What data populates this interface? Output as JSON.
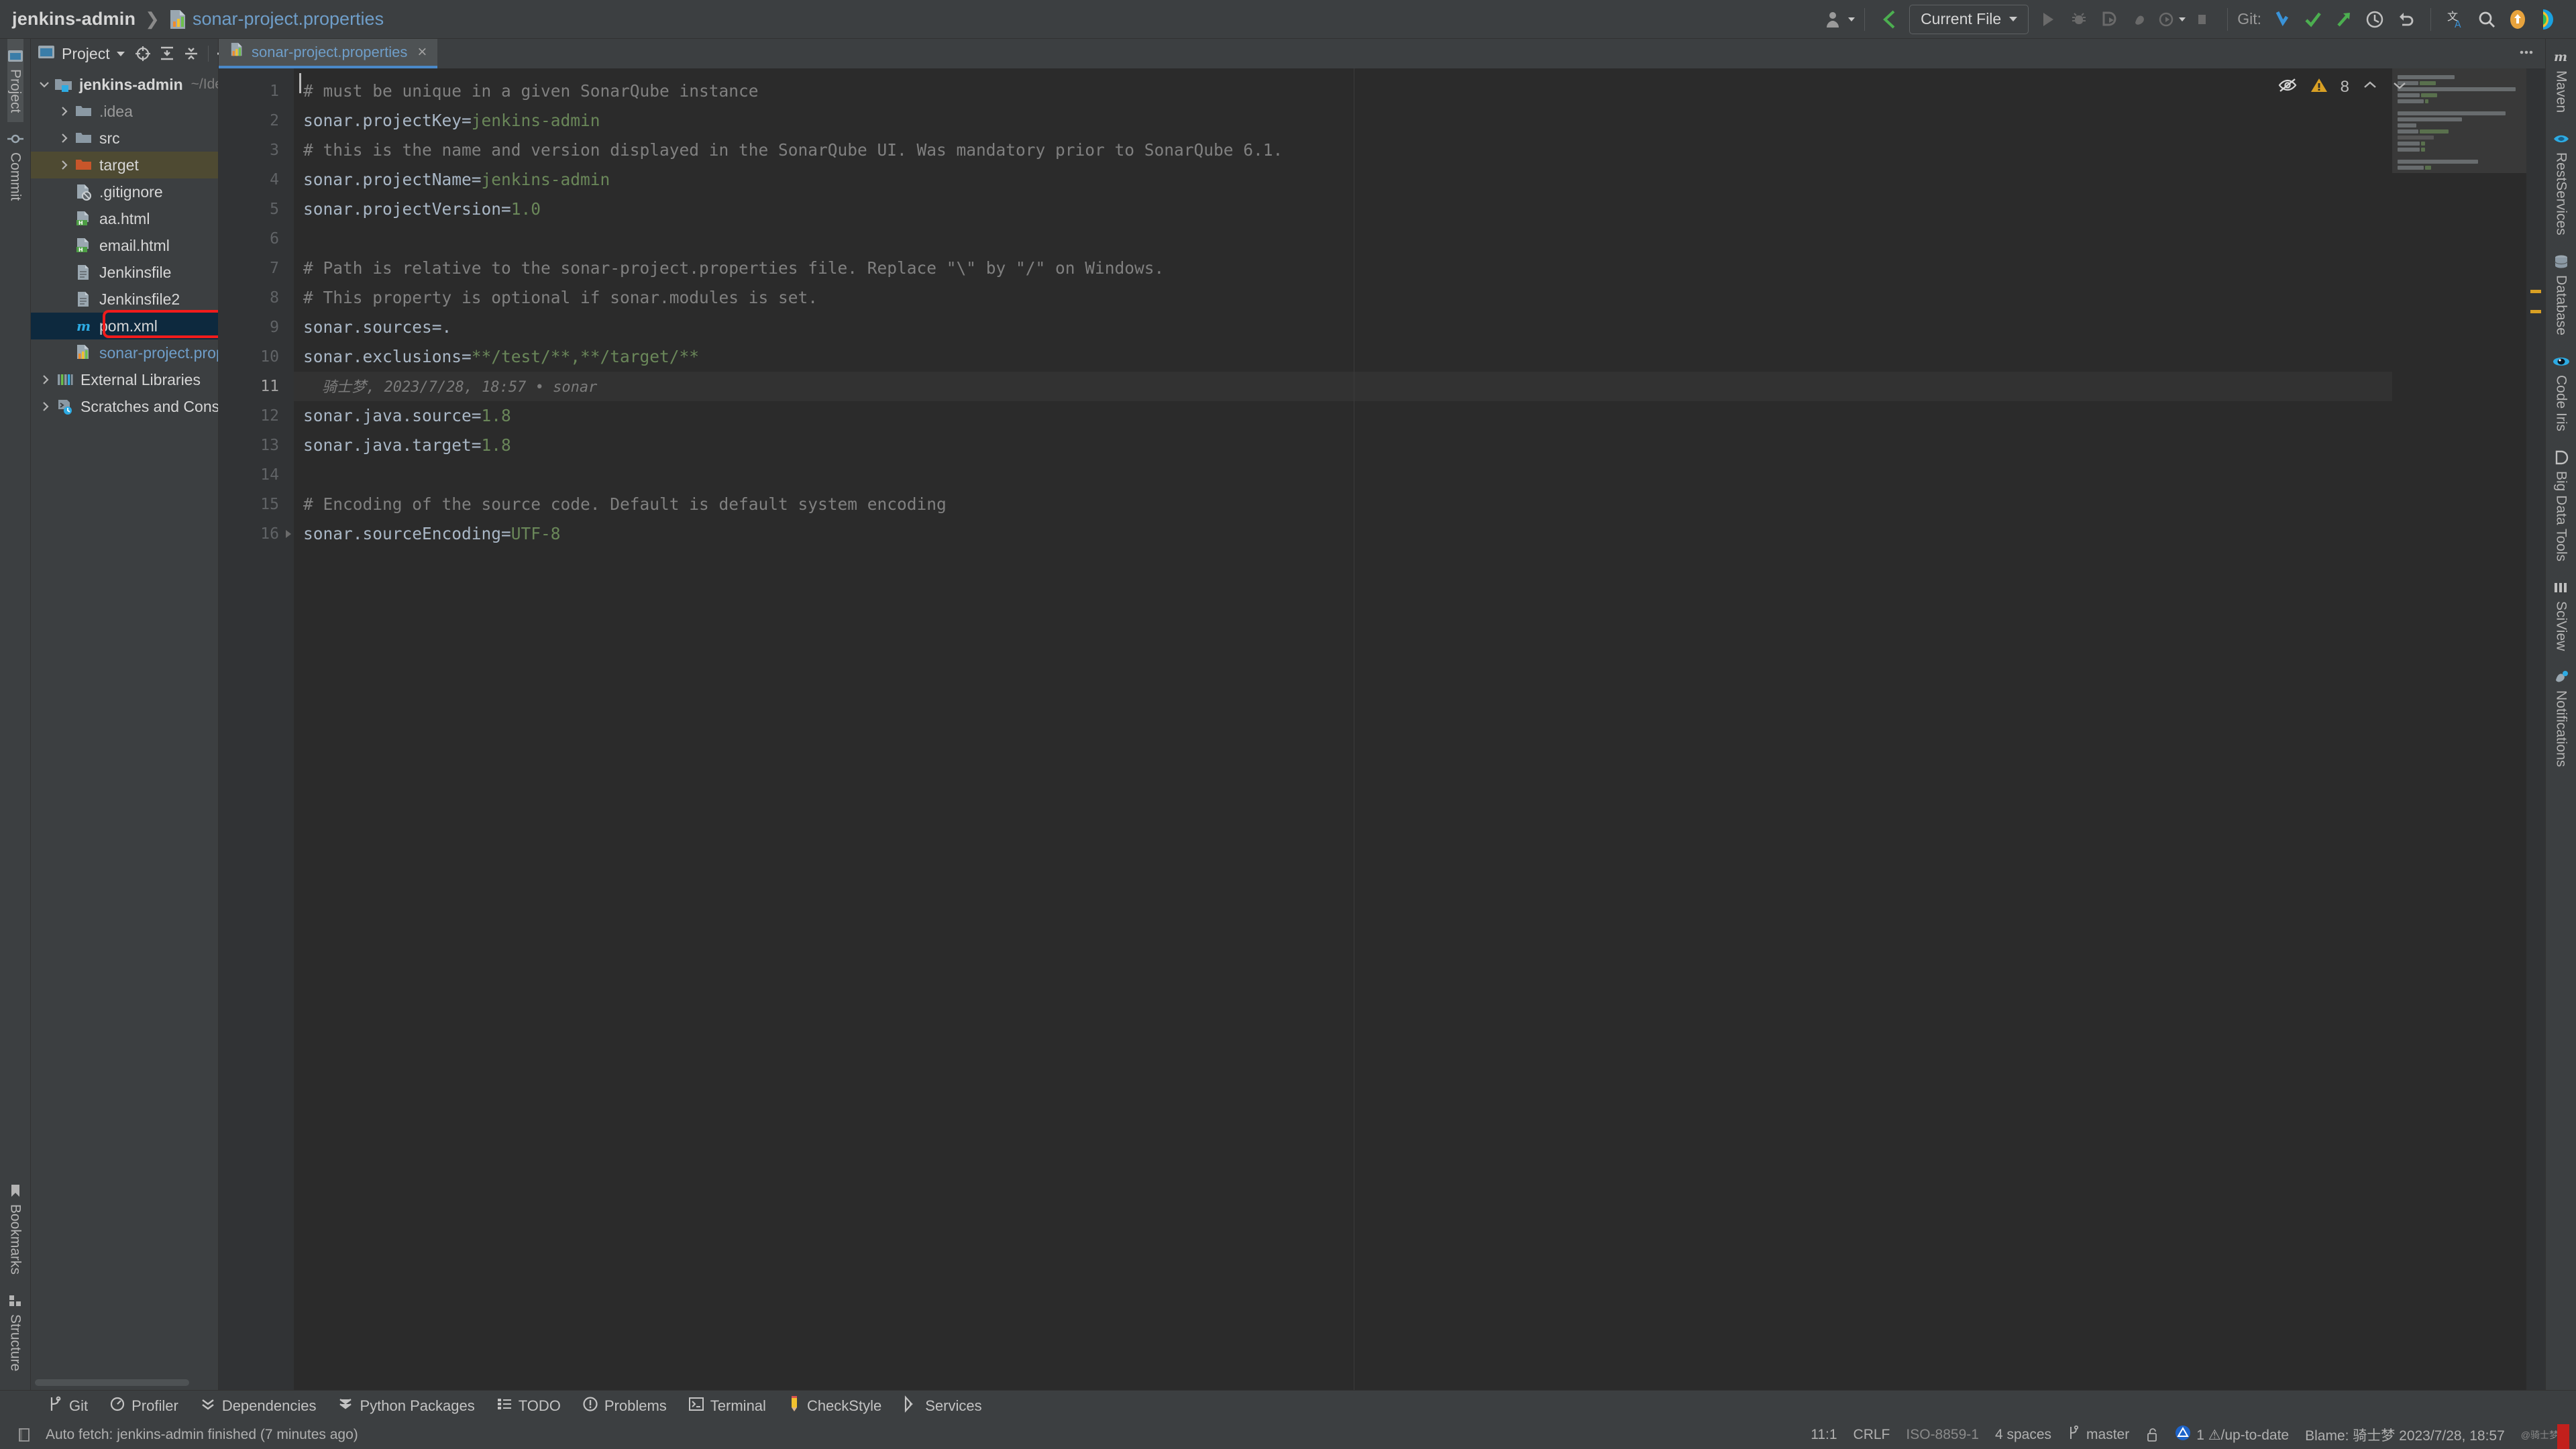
{
  "window": {
    "breadcrumb_project": "jenkins-admin",
    "breadcrumb_file": "sonar-project.properties"
  },
  "toolbar": {
    "run_config": "Current File",
    "git_label": "Git:",
    "icons": [
      "user-avatar-icon",
      "back-arrow-icon",
      "run-icon",
      "debug-icon",
      "run-with-coverage-icon",
      "profile-icon",
      "more-run-icon",
      "stop-icon",
      "update-project-icon",
      "commit-icon",
      "push-icon",
      "history-icon",
      "rollback-icon",
      "translate-icon",
      "search-everywhere-icon",
      "notifications-icon",
      "ide-color-icon"
    ]
  },
  "project_panel": {
    "title": "Project",
    "tools": [
      "locate-icon",
      "expand-all-icon",
      "collapse-all-icon",
      "settings-icon",
      "hide-icon"
    ],
    "root": {
      "label": "jenkins-admin",
      "path": "~/IdeaProjects/learn/jenkins/jenkins-a"
    },
    "items": [
      {
        "label": ".idea",
        "kind": "folder",
        "expandable": true,
        "indent": 1,
        "dim": true
      },
      {
        "label": "src",
        "kind": "folder",
        "expandable": true,
        "indent": 1
      },
      {
        "label": "target",
        "kind": "folder-orange",
        "expandable": true,
        "indent": 1,
        "row": "target"
      },
      {
        "label": ".gitignore",
        "kind": "gitignore-file",
        "expandable": false,
        "indent": 2
      },
      {
        "label": "aa.html",
        "kind": "html-file",
        "expandable": false,
        "indent": 2
      },
      {
        "label": "email.html",
        "kind": "html-file",
        "expandable": false,
        "indent": 2
      },
      {
        "label": "Jenkinsfile",
        "kind": "text-file",
        "expandable": false,
        "indent": 2
      },
      {
        "label": "Jenkinsfile2",
        "kind": "text-file",
        "expandable": false,
        "indent": 2
      },
      {
        "label": "pom.xml",
        "kind": "maven-file",
        "expandable": false,
        "indent": 2,
        "row": "selected"
      },
      {
        "label": "sonar-project.properties",
        "kind": "sonar-file",
        "expandable": false,
        "indent": 2,
        "blue": true,
        "annotated": true
      },
      {
        "label": "External Libraries",
        "kind": "libraries",
        "expandable": true,
        "indent": 0
      },
      {
        "label": "Scratches and Consoles",
        "kind": "scratches",
        "expandable": true,
        "indent": 0
      }
    ]
  },
  "left_strip": [
    {
      "label": "Project",
      "icon": "project-icon",
      "active": true
    },
    {
      "label": "Commit",
      "icon": "commit-icon",
      "active": false
    }
  ],
  "left_strip_bottom": [
    {
      "label": "Bookmarks",
      "icon": "bookmark-icon"
    },
    {
      "label": "Structure",
      "icon": "structure-icon"
    }
  ],
  "right_strip": [
    {
      "label": "Maven",
      "icon": "maven-icon"
    },
    {
      "label": "RestServices",
      "icon": "rest-icon"
    },
    {
      "label": "Database",
      "icon": "database-icon"
    },
    {
      "label": "Code Iris",
      "icon": "code-iris-icon"
    },
    {
      "label": "Big Data Tools",
      "icon": "big-data-icon"
    },
    {
      "label": "SciView",
      "icon": "sciview-icon"
    },
    {
      "label": "Notifications",
      "icon": "notifications-icon"
    }
  ],
  "editor": {
    "tab_label": "sonar-project.properties",
    "tab_close": "×",
    "warning_count": "8",
    "inspection_icons": [
      "eye-off-icon",
      "warning-triangle-icon",
      "prev-problem-icon",
      "next-problem-icon"
    ],
    "total_lines": 16,
    "active_line": 11,
    "lines": [
      {
        "n": 1,
        "segments": [
          {
            "t": "# must be unique in a given SonarQube instance",
            "c": "cm"
          }
        ]
      },
      {
        "n": 2,
        "segments": [
          {
            "t": "sonar.projectKey=",
            "c": "key"
          },
          {
            "t": "jenkins-admin",
            "c": "val"
          }
        ]
      },
      {
        "n": 3,
        "segments": [
          {
            "t": "# this is the name and version displayed in the SonarQube UI. Was mandatory prior to SonarQube 6.1.",
            "c": "cm"
          }
        ]
      },
      {
        "n": 4,
        "segments": [
          {
            "t": "sonar.projectName=",
            "c": "key"
          },
          {
            "t": "jenkins-admin",
            "c": "val"
          }
        ]
      },
      {
        "n": 5,
        "segments": [
          {
            "t": "sonar.projectVersion=",
            "c": "key"
          },
          {
            "t": "1.0",
            "c": "val"
          }
        ]
      },
      {
        "n": 6,
        "segments": []
      },
      {
        "n": 7,
        "segments": [
          {
            "t": "# Path is relative to the sonar-project.properties file. Replace \"\\\" by \"/\" on Windows.",
            "c": "cm"
          }
        ]
      },
      {
        "n": 8,
        "segments": [
          {
            "t": "# This property is optional if sonar.modules is set.",
            "c": "cm"
          }
        ]
      },
      {
        "n": 9,
        "segments": [
          {
            "t": "sonar.sources=.",
            "c": "key"
          }
        ]
      },
      {
        "n": 10,
        "segments": [
          {
            "t": "sonar.exclusions=",
            "c": "key"
          },
          {
            "t": "**/test/**,**/target/**",
            "c": "val"
          }
        ]
      },
      {
        "n": 11,
        "segments": [
          {
            "t": "骑士梦, 2023/7/28, 18:57 • sonar",
            "c": "blame"
          }
        ]
      },
      {
        "n": 12,
        "segments": [
          {
            "t": "sonar.java.source=",
            "c": "key"
          },
          {
            "t": "1.8",
            "c": "val"
          }
        ]
      },
      {
        "n": 13,
        "segments": [
          {
            "t": "sonar.java.target=",
            "c": "key"
          },
          {
            "t": "1.8",
            "c": "val"
          }
        ]
      },
      {
        "n": 14,
        "segments": []
      },
      {
        "n": 15,
        "segments": [
          {
            "t": "# Encoding of the source code. Default is default system encoding",
            "c": "cm"
          }
        ]
      },
      {
        "n": 16,
        "segments": [
          {
            "t": "sonar.sourceEncoding=",
            "c": "key"
          },
          {
            "t": "UTF-8",
            "c": "val"
          }
        ]
      }
    ]
  },
  "bottom_tabs": [
    {
      "label": "Git",
      "icon": "git-branch-icon"
    },
    {
      "label": "Profiler",
      "icon": "profiler-icon"
    },
    {
      "label": "Dependencies",
      "icon": "dependencies-icon"
    },
    {
      "label": "Python Packages",
      "icon": "python-packages-icon"
    },
    {
      "label": "TODO",
      "icon": "todo-icon"
    },
    {
      "label": "Problems",
      "icon": "problems-icon"
    },
    {
      "label": "Terminal",
      "icon": "terminal-icon"
    },
    {
      "label": "CheckStyle",
      "icon": "checkstyle-icon"
    },
    {
      "label": "Services",
      "icon": "services-icon"
    }
  ],
  "status": {
    "message": "Auto fetch: jenkins-admin finished (7 minutes ago)",
    "message_icon": "event-log-icon",
    "caret": "11:1",
    "line_sep": "CRLF",
    "encoding": "ISO-8859-1",
    "indent": "4 spaces",
    "branch": "master",
    "branch_icon": "git-branch-icon",
    "lock_icon": "unlock-icon",
    "inspection": "1 ⚠/up-to-date",
    "blame": "Blame: 骑士梦 2023/7/28, 18:57",
    "blame_extra": "@骑士梦"
  },
  "colors": {
    "bg_panel": "#3c3f41",
    "bg_editor": "#2b2b2b",
    "accent_blue": "#4a88c7",
    "link_blue": "#6f9ec9",
    "comment_gray": "#808080",
    "string_green": "#6a8759",
    "target_row": "#4e4a32",
    "selected_row": "#0d293e",
    "annotation_red": "#f01c1c",
    "warning_yellow": "#d9a024"
  }
}
